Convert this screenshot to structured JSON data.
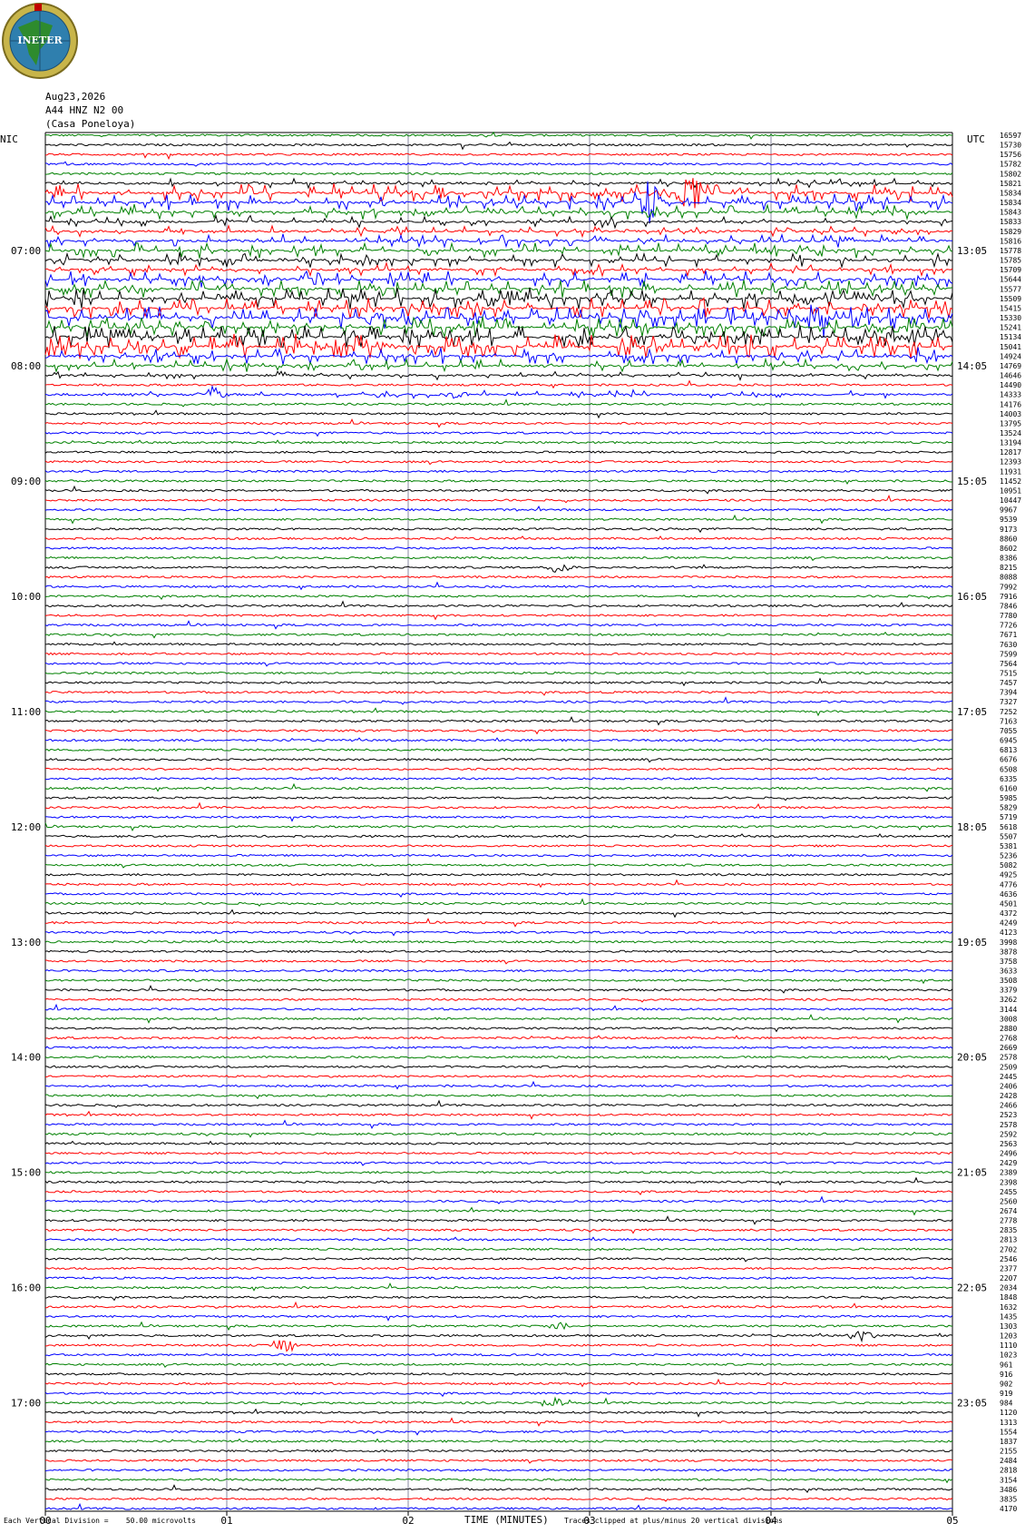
{
  "logo": {
    "text": "INETER",
    "colors": {
      "ring": "#c8b54a",
      "globe": "#2f7fae",
      "land": "#2e8b2e",
      "flag": "#c00000"
    }
  },
  "header": {
    "date": "Aug23,2026",
    "channel": "A44 HNZ N2 00",
    "site": "(Casa Poneloya)"
  },
  "labels": {
    "left_zone": "NIC",
    "right_zone": "UTC"
  },
  "footer": {
    "scale_text": "Each Vertical Division =    50.00 microvolts",
    "clip_text": "Traces clipped at plus/minus 20 vertical divisions"
  },
  "chart_data": {
    "type": "line",
    "title": "",
    "xlabel": "TIME (MINUTES)",
    "ylabel": "",
    "xlim": [
      0,
      5
    ],
    "x_ticks": [
      "00",
      "01",
      "02",
      "03",
      "04",
      "05"
    ],
    "grid": true,
    "trace_colors": [
      "#000000",
      "#ff0000",
      "#0000ff",
      "#008000"
    ],
    "start_trace_color": 3,
    "left_time_labels": [
      "07:00",
      "08:00",
      "09:00",
      "10:00",
      "11:00",
      "12:00",
      "13:00",
      "14:00",
      "15:00",
      "16:00",
      "17:00"
    ],
    "right_time_labels": [
      "13:05",
      "14:05",
      "15:05",
      "16:05",
      "17:05",
      "18:05",
      "19:05",
      "20:05",
      "21:05",
      "22:05",
      "23:05"
    ],
    "first_label_trace": 12,
    "traces_per_hour": 12,
    "amplitudes": [
      "16597",
      "15730",
      "15756",
      "15782",
      "15802",
      "15821",
      "15834",
      "15834",
      "15843",
      "15833",
      "15829",
      "15816",
      "15778",
      "15785",
      "15709",
      "15644",
      "15577",
      "15509",
      "15415",
      "15330",
      "15241",
      "15134",
      "15041",
      "14924",
      "14769",
      "14646",
      "14490",
      "14333",
      "14176",
      "14003",
      "13795",
      "13524",
      "13194",
      "12817",
      "12393",
      "11931",
      "11452",
      "10951",
      "10447",
      "9967",
      "9539",
      "9173",
      "8860",
      "8602",
      "8386",
      "8215",
      "8088",
      "7992",
      "7916",
      "7846",
      "7780",
      "7726",
      "7671",
      "7630",
      "7599",
      "7564",
      "7515",
      "7457",
      "7394",
      "7327",
      "7252",
      "7163",
      "7055",
      "6945",
      "6813",
      "6676",
      "6508",
      "6335",
      "6160",
      "5985",
      "5829",
      "5719",
      "5618",
      "5507",
      "5381",
      "5236",
      "5082",
      "4925",
      "4776",
      "4636",
      "4501",
      "4372",
      "4249",
      "4123",
      "3998",
      "3878",
      "3758",
      "3633",
      "3508",
      "3379",
      "3262",
      "3144",
      "3008",
      "2880",
      "2768",
      "2669",
      "2578",
      "2509",
      "2445",
      "2406",
      "2428",
      "2466",
      "2523",
      "2578",
      "2592",
      "2563",
      "2496",
      "2429",
      "2389",
      "2398",
      "2455",
      "2560",
      "2674",
      "2778",
      "2835",
      "2813",
      "2702",
      "2546",
      "2377",
      "2207",
      "2034",
      "1848",
      "1632",
      "1435",
      "1303",
      "1203",
      "1110",
      "1023",
      "961",
      "916",
      "902",
      "919",
      "984",
      "1120",
      "1313",
      "1554",
      "1837",
      "2155",
      "2484",
      "2818",
      "3154",
      "3486",
      "3835",
      "4170"
    ],
    "noise_profile": [
      2,
      2,
      2,
      3,
      3,
      4,
      9,
      8,
      7,
      6,
      5,
      6,
      7,
      7,
      6,
      8,
      9,
      10,
      10,
      11,
      10,
      11,
      12,
      8,
      6,
      4,
      3,
      4,
      3,
      3,
      2,
      2,
      2,
      2,
      2,
      2,
      2,
      2,
      2,
      2,
      2,
      2,
      2,
      2,
      2,
      2,
      2,
      2,
      2,
      2,
      2,
      2,
      2,
      2,
      2,
      2,
      2,
      2,
      2,
      2,
      2,
      2,
      2,
      2,
      2,
      2,
      2,
      2,
      2,
      2,
      2,
      2,
      2,
      2,
      2,
      2,
      2,
      2,
      2,
      2,
      2,
      2,
      2,
      2,
      2,
      2,
      2,
      2,
      2,
      2,
      2,
      2,
      2,
      2,
      2,
      2,
      2,
      2,
      2,
      2,
      2,
      2,
      2,
      2,
      2,
      2,
      2,
      2,
      2,
      2,
      2,
      2,
      2,
      2,
      2,
      2,
      2,
      2,
      2,
      2,
      2,
      2,
      2,
      2,
      2,
      2,
      2,
      2,
      2,
      2,
      2,
      2,
      2,
      2,
      2,
      2,
      2,
      2,
      2,
      2,
      2,
      2,
      2,
      2
    ],
    "events": [
      {
        "trace": 6,
        "t": 3.55,
        "amp": 28
      },
      {
        "trace": 7,
        "t": 3.33,
        "amp": 26
      },
      {
        "trace": 19,
        "t": 4.25,
        "amp": 22
      },
      {
        "trace": 27,
        "t": 0.92,
        "amp": 10
      },
      {
        "trace": 27,
        "t": 2.27,
        "amp": 6
      },
      {
        "trace": 45,
        "t": 2.83,
        "amp": 6
      },
      {
        "trace": 124,
        "t": 2.85,
        "amp": 6
      },
      {
        "trace": 126,
        "t": 1.32,
        "amp": 9
      },
      {
        "trace": 132,
        "t": 2.82,
        "amp": 9
      },
      {
        "trace": 125,
        "t": 4.5,
        "amp": 7
      }
    ]
  }
}
